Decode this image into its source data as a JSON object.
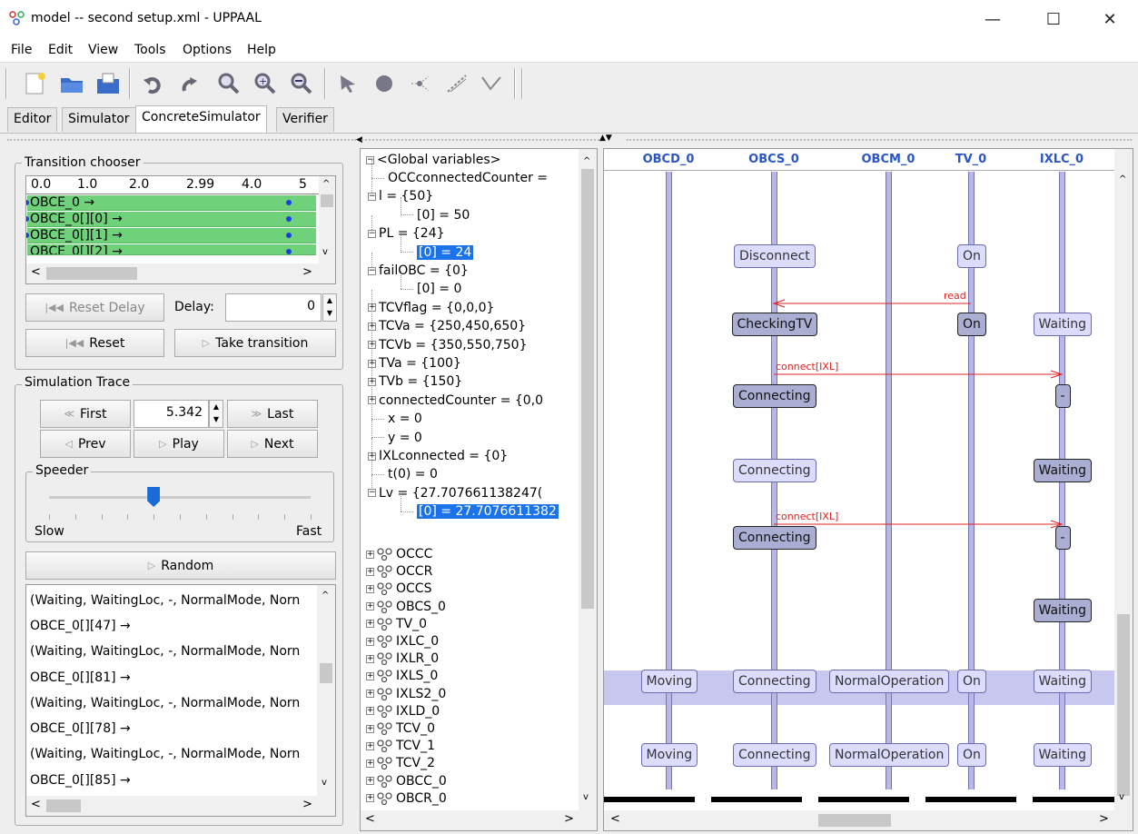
{
  "window": {
    "title": "model -- second setup.xml - UPPAAL",
    "minimize_glyph": "—",
    "maximize_glyph": "☐",
    "close_glyph": "✕"
  },
  "menu": [
    "File",
    "Edit",
    "View",
    "Tools",
    "Options",
    "Help"
  ],
  "toolbar_icons": [
    "new-file-icon",
    "open-file-icon",
    "save-file-icon",
    "undo-icon",
    "redo-icon",
    "zoom-icon",
    "zoom-in-icon",
    "zoom-out-icon",
    "select-tool-icon",
    "location-tool-icon",
    "branch-tool-icon",
    "edge-tool-icon",
    "nail-tool-icon"
  ],
  "tabs": [
    "Editor",
    "Simulator",
    "ConcreteSimulator",
    "Verifier"
  ],
  "active_tab": "ConcreteSimulator",
  "transition_chooser": {
    "title": "Transition chooser",
    "ruler": [
      "0.0",
      "1.0",
      "2.0",
      "2.99",
      "4.0",
      "5"
    ],
    "rows": [
      "OBCE_0 →",
      "OBCE_0[][0] →",
      "OBCE_0[][1] →",
      "OBCE_0[][2] →"
    ],
    "reset_delay": "Reset Delay",
    "delay_label": "Delay:",
    "delay_value": "0",
    "reset": "Reset",
    "take_transition": "Take transition"
  },
  "simulation_trace": {
    "title": "Simulation Trace",
    "first": "First",
    "last": "Last",
    "prev": "Prev",
    "play": "Play",
    "next": "Next",
    "time_value": "5.342",
    "speeder_title": "Speeder",
    "slow": "Slow",
    "fast": "Fast",
    "random": "Random",
    "speed_fraction": 0.4,
    "lines": [
      "(Waiting, WaitingLoc, -, NormalMode, Norn",
      "OBCE_0[][47] →",
      "(Waiting, WaitingLoc, -, NormalMode, Norn",
      "OBCE_0[][81] →",
      "(Waiting, WaitingLoc, -, NormalMode, Norn",
      "OBCE_0[][78] →",
      "(Waiting, WaitingLoc, -, NormalMode, Norn",
      "OBCE_0[][85] →"
    ]
  },
  "variables": {
    "root": "<Global variables>",
    "items": [
      {
        "depth": 1,
        "toggle": "",
        "text": "OCCconnectedCounter ="
      },
      {
        "depth": 1,
        "toggle": "−",
        "text": "l = {50}"
      },
      {
        "depth": 2,
        "toggle": "",
        "text": "[0] = 50"
      },
      {
        "depth": 1,
        "toggle": "−",
        "text": "PL = {24}"
      },
      {
        "depth": 2,
        "toggle": "",
        "text": "[0] = 24",
        "selected": true
      },
      {
        "depth": 1,
        "toggle": "−",
        "text": "failOBC = {0}"
      },
      {
        "depth": 2,
        "toggle": "",
        "text": "[0] = 0"
      },
      {
        "depth": 1,
        "toggle": "+",
        "text": "TCVflag = {0,0,0}"
      },
      {
        "depth": 1,
        "toggle": "+",
        "text": "TCVa = {250,450,650}"
      },
      {
        "depth": 1,
        "toggle": "+",
        "text": "TCVb = {350,550,750}"
      },
      {
        "depth": 1,
        "toggle": "+",
        "text": "TVa = {100}"
      },
      {
        "depth": 1,
        "toggle": "+",
        "text": "TVb = {150}"
      },
      {
        "depth": 1,
        "toggle": "+",
        "text": "connectedCounter = {0,0"
      },
      {
        "depth": 1,
        "toggle": "",
        "text": "x = 0"
      },
      {
        "depth": 1,
        "toggle": "",
        "text": "y = 0"
      },
      {
        "depth": 1,
        "toggle": "+",
        "text": "IXLconnected = {0}"
      },
      {
        "depth": 1,
        "toggle": "",
        "text": "t(0) = 0"
      },
      {
        "depth": 1,
        "toggle": "−",
        "text": "Lv = {27.707661138247("
      },
      {
        "depth": 2,
        "toggle": "",
        "text": "[0] = 27.7076611382",
        "selected": true
      }
    ],
    "processes": [
      "OCCC",
      "OCCR",
      "OCCS",
      "OBCS_0",
      "TV_0",
      "IXLC_0",
      "IXLR_0",
      "IXLS_0",
      "IXLS2_0",
      "IXLD_0",
      "TCV_0",
      "TCV_1",
      "TCV_2",
      "OBCC_0",
      "OBCR_0"
    ]
  },
  "msc": {
    "headers": [
      "OBCD_0",
      "OBCS_0",
      "OBCM_0",
      "TV_0",
      "IXLC_0"
    ],
    "states": [
      {
        "lane": 1,
        "row": 0,
        "text": "Disconnect",
        "style": "light"
      },
      {
        "lane": 3,
        "row": 0,
        "text": "On",
        "style": "light"
      },
      {
        "lane": 1,
        "row": 1,
        "text": "CheckingTV",
        "style": "dark"
      },
      {
        "lane": 3,
        "row": 1,
        "text": "On",
        "style": "dark"
      },
      {
        "lane": 4,
        "row": 1,
        "text": "Waiting",
        "style": "light"
      },
      {
        "lane": 1,
        "row": 2,
        "text": "Connecting",
        "style": "dark"
      },
      {
        "lane": 4,
        "row": 2,
        "text": "-",
        "style": "dark"
      },
      {
        "lane": 1,
        "row": 3,
        "text": "Connecting",
        "style": "light"
      },
      {
        "lane": 4,
        "row": 3,
        "text": "Waiting",
        "style": "dark"
      },
      {
        "lane": 1,
        "row": 4,
        "text": "Connecting",
        "style": "dark"
      },
      {
        "lane": 4,
        "row": 4,
        "text": "-",
        "style": "dark"
      },
      {
        "lane": 4,
        "row": 5,
        "text": "Waiting",
        "style": "dark"
      },
      {
        "lane": 0,
        "row": 6,
        "text": "Moving",
        "style": "light"
      },
      {
        "lane": 1,
        "row": 6,
        "text": "Connecting",
        "style": "light"
      },
      {
        "lane": 2,
        "row": 6,
        "text": "NormalOperation",
        "style": "light"
      },
      {
        "lane": 3,
        "row": 6,
        "text": "On",
        "style": "light"
      },
      {
        "lane": 4,
        "row": 6,
        "text": "Waiting",
        "style": "light"
      },
      {
        "lane": 0,
        "row": 7,
        "text": "Moving",
        "style": "light"
      },
      {
        "lane": 1,
        "row": 7,
        "text": "Connecting",
        "style": "light"
      },
      {
        "lane": 2,
        "row": 7,
        "text": "NormalOperation",
        "style": "light"
      },
      {
        "lane": 3,
        "row": 7,
        "text": "On",
        "style": "light"
      },
      {
        "lane": 4,
        "row": 7,
        "text": "Waiting",
        "style": "light"
      }
    ],
    "messages": [
      {
        "label": "read",
        "from": 3,
        "to": 1
      },
      {
        "label": "connect[IXL]",
        "from": 1,
        "to": 4
      },
      {
        "label": "connect[IXL]",
        "from": 1,
        "to": 4
      }
    ]
  },
  "colors": {
    "transition_green": "#6fd27a",
    "selection_blue": "#1a73e8",
    "msc_header_blue": "#2a55c8",
    "message_red": "#e02020",
    "highlight_band": "#c8c8ee"
  }
}
